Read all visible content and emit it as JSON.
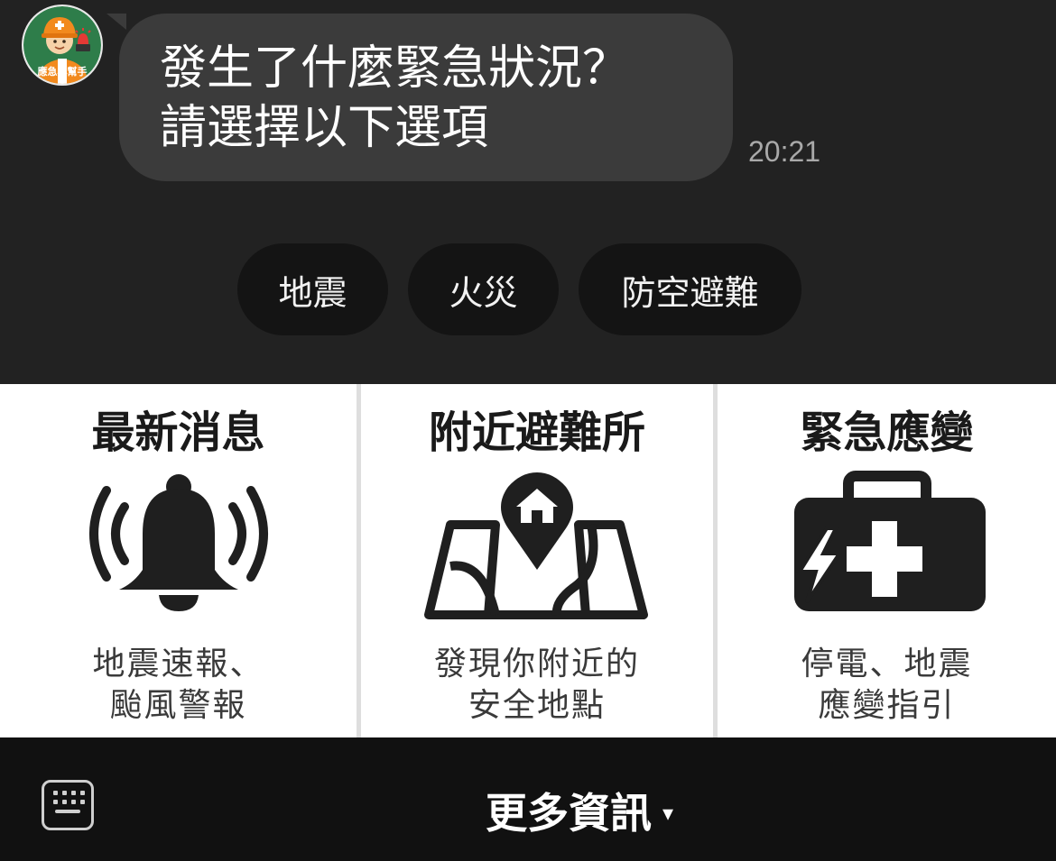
{
  "chat": {
    "bot_avatar_label": "應急小幫手",
    "message_lines": [
      "發生了什麼緊急狀況？",
      "請選擇以下選項"
    ],
    "time": "20:21"
  },
  "quick_replies": [
    "地震",
    "火災",
    "防空避難"
  ],
  "menu": {
    "cards": [
      {
        "title": "最新消息",
        "icon": "bell-ringing-icon",
        "desc": [
          "地震速報、",
          "颱風警報"
        ]
      },
      {
        "title": "附近避難所",
        "icon": "map-pin-house-icon",
        "desc": [
          "發現你附近的",
          "安全地點"
        ]
      },
      {
        "title": "緊急應變",
        "icon": "emergency-kit-icon",
        "desc": [
          "停電、地震",
          "應變指引"
        ]
      }
    ]
  },
  "bottom_bar": {
    "keyboard_icon": "keyboard-icon",
    "more_label": "更多資訊",
    "more_caret": "▾"
  },
  "colors": {
    "chat_bg": "#222222",
    "bubble_bg": "#3b3b3b",
    "chip_bg": "#141414",
    "menu_bg": "#ffffff",
    "bottom_bar_bg": "#111111",
    "avatar_green": "#2e7d4a",
    "avatar_orange": "#f28a1e"
  }
}
